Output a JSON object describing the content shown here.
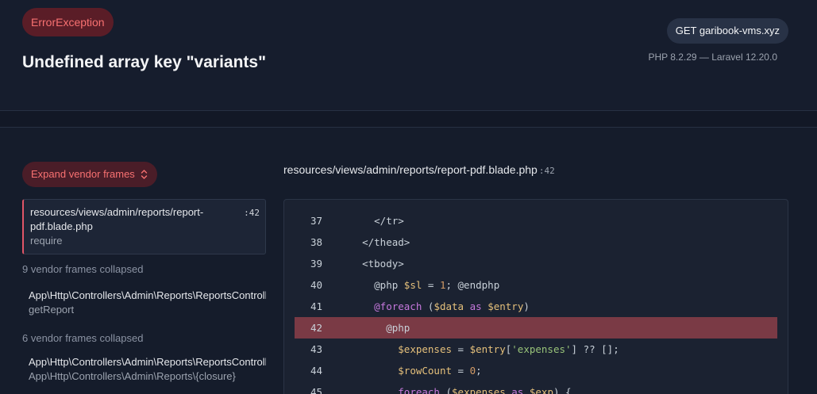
{
  "header": {
    "exception_type": "ErrorException",
    "message": "Undefined array key \"variants\"",
    "request": "GET garibook-vms.xyz",
    "versions": "PHP 8.2.29 — Laravel 12.20.0"
  },
  "sidebar": {
    "expand_label": "Expand vendor frames",
    "active_frame": {
      "file": "resources/views/admin/reports/report-pdf.blade.php",
      "function": "require",
      "line": ":42"
    },
    "collapsed_1": "9 vendor frames collapsed",
    "frame_2": {
      "class": "App\\Http\\Controllers\\Admin\\Reports\\ReportsController",
      "function": "getReport"
    },
    "collapsed_2": "6 vendor frames collapsed",
    "frame_3": {
      "class": "App\\Http\\Controllers\\Admin\\Reports\\ReportsController",
      "function": "App\\Http\\Controllers\\Admin\\Reports\\{closure}"
    }
  },
  "code": {
    "file": "resources/views/admin/reports/report-pdf.blade.php",
    "line_label": ":42",
    "highlight_line": 42,
    "lines": [
      {
        "num": "37",
        "text": "      </tr>"
      },
      {
        "num": "38",
        "text": "    </thead>"
      },
      {
        "num": "39",
        "text": "    <tbody>"
      },
      {
        "num": "40",
        "text": "      @php $sl = 1; @endphp"
      },
      {
        "num": "41",
        "text": "      @foreach ($data as $entry)"
      },
      {
        "num": "42",
        "text": "        @php"
      },
      {
        "num": "43",
        "text": "          $expenses = $entry['expenses'] ?? [];"
      },
      {
        "num": "44",
        "text": "          $rowCount = 0;"
      },
      {
        "num": "45",
        "text": "          foreach ($expenses as $exp) {"
      }
    ]
  },
  "colors": {
    "accent_red": "#f87171",
    "highlight_row": "#7a3a45",
    "background": "#151c2b"
  },
  "icons": {
    "expand": "chevron-up-down-icon"
  }
}
